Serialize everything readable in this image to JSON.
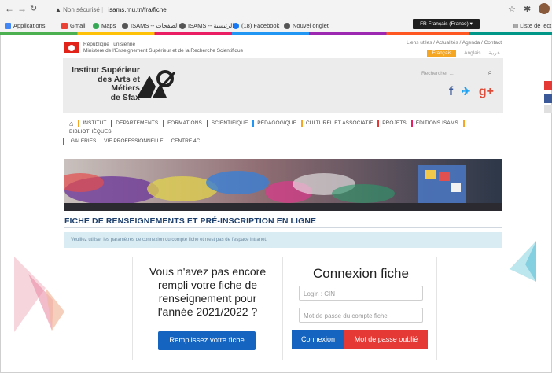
{
  "browser": {
    "not_secure": "Non sécurisé",
    "url": "isams.rnu.tn/fra/fiche",
    "translate_popup": "FR Français (France)",
    "bookmarks": [
      {
        "label": "Applications",
        "color": "#4285f4"
      },
      {
        "label": "Gmail",
        "color": "#ea4335"
      },
      {
        "label": "Maps",
        "color": "#34a853"
      },
      {
        "label": "ISAMS -- الصفحات",
        "color": "#555555"
      },
      {
        "label": "ISAMS -- الرئيسية",
        "color": "#555555"
      },
      {
        "label": "(18) Facebook",
        "color": "#1877f2"
      },
      {
        "label": "Nouvel onglet",
        "color": "#555555"
      }
    ],
    "reading_list": "Liste de lect"
  },
  "gov": {
    "line1": "République Tunisienne",
    "line2": "Ministère de l'Enseignement Supérieur et de la Recherche Scientifique",
    "util_links": "Liens utiles / Actualités / Agenda / Contact",
    "lang_fr": "Français",
    "lang_en": "Anglais",
    "lang_ar": "عربية"
  },
  "header": {
    "institute_line1": "Institut Supérieur",
    "institute_line2": "des Arts et Métiers",
    "institute_line3": "de Sfax",
    "search_placeholder": "Rechercher ...",
    "social": {
      "facebook": "f",
      "twitter": "t",
      "googleplus": "g+"
    }
  },
  "menu": {
    "items": [
      {
        "label": "INSTITUT",
        "color": "#f5a623"
      },
      {
        "label": "DÉPARTEMENTS",
        "color": "#e91e63"
      },
      {
        "label": "FORMATIONS",
        "color": "#e53935"
      },
      {
        "label": "SCIENTIFIQUE",
        "color": "#e91e63"
      },
      {
        "label": "PÉDAGOGIQUE",
        "color": "#2196f3"
      },
      {
        "label": "CULTUREL ET ASSOCIATIF",
        "color": "#f5a623"
      },
      {
        "label": "PROJETS",
        "color": "#e53935"
      },
      {
        "label": "ÉDITIONS ISAMS",
        "color": "#e91e63"
      },
      {
        "label": "BIBLIOTHÈQUES",
        "color": "#f5a623"
      }
    ],
    "row2": [
      "GALERIES",
      "VIE PROFESSIONNELLE",
      "CENTRE 4C"
    ],
    "row2_marker_color": "#e53935"
  },
  "page": {
    "headline": "FICHE DE RENSEIGNEMENTS ET PRÉ-INSCRIPTION EN LIGNE",
    "notice": "Veuillez utiliser les paramètres de connexion du compte fiche et n'est pas de l'espace intranet.",
    "left_card": {
      "question": "Vous n'avez pas encore rempli votre fiche de renseignement pour l'année 2021/2022 ?",
      "button": "Remplissez votre fiche"
    },
    "right_card": {
      "title": "Connexion fiche",
      "login_placeholder": "Login : CIN",
      "password_placeholder": "Mot de passe du compte fiche",
      "login_button": "Connexion",
      "forgot_button": "Mot de passe oublié"
    }
  },
  "colors": {
    "primary": "#1565c0",
    "danger": "#e53935",
    "headline": "#1d3f6d",
    "accent": "#f5a623"
  }
}
